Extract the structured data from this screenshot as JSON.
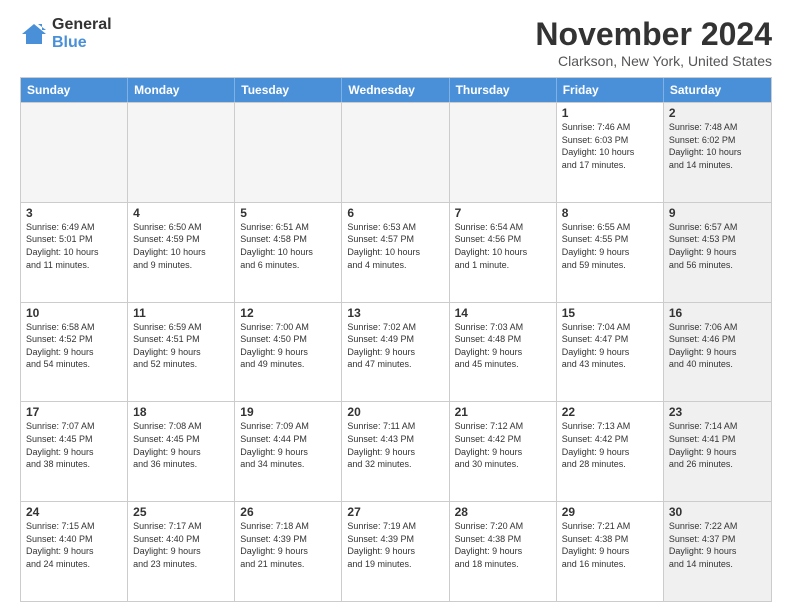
{
  "logo": {
    "general": "General",
    "blue": "Blue"
  },
  "title": "November 2024",
  "location": "Clarkson, New York, United States",
  "days_of_week": [
    "Sunday",
    "Monday",
    "Tuesday",
    "Wednesday",
    "Thursday",
    "Friday",
    "Saturday"
  ],
  "weeks": [
    [
      {
        "day": "",
        "empty": true
      },
      {
        "day": "",
        "empty": true
      },
      {
        "day": "",
        "empty": true
      },
      {
        "day": "",
        "empty": true
      },
      {
        "day": "",
        "empty": true
      },
      {
        "day": "1",
        "lines": [
          "Sunrise: 7:46 AM",
          "Sunset: 6:03 PM",
          "Daylight: 10 hours",
          "and 17 minutes."
        ]
      },
      {
        "day": "2",
        "shaded": true,
        "lines": [
          "Sunrise: 7:48 AM",
          "Sunset: 6:02 PM",
          "Daylight: 10 hours",
          "and 14 minutes."
        ]
      }
    ],
    [
      {
        "day": "3",
        "lines": [
          "Sunrise: 6:49 AM",
          "Sunset: 5:01 PM",
          "Daylight: 10 hours",
          "and 11 minutes."
        ]
      },
      {
        "day": "4",
        "lines": [
          "Sunrise: 6:50 AM",
          "Sunset: 4:59 PM",
          "Daylight: 10 hours",
          "and 9 minutes."
        ]
      },
      {
        "day": "5",
        "lines": [
          "Sunrise: 6:51 AM",
          "Sunset: 4:58 PM",
          "Daylight: 10 hours",
          "and 6 minutes."
        ]
      },
      {
        "day": "6",
        "lines": [
          "Sunrise: 6:53 AM",
          "Sunset: 4:57 PM",
          "Daylight: 10 hours",
          "and 4 minutes."
        ]
      },
      {
        "day": "7",
        "lines": [
          "Sunrise: 6:54 AM",
          "Sunset: 4:56 PM",
          "Daylight: 10 hours",
          "and 1 minute."
        ]
      },
      {
        "day": "8",
        "lines": [
          "Sunrise: 6:55 AM",
          "Sunset: 4:55 PM",
          "Daylight: 9 hours",
          "and 59 minutes."
        ]
      },
      {
        "day": "9",
        "shaded": true,
        "lines": [
          "Sunrise: 6:57 AM",
          "Sunset: 4:53 PM",
          "Daylight: 9 hours",
          "and 56 minutes."
        ]
      }
    ],
    [
      {
        "day": "10",
        "lines": [
          "Sunrise: 6:58 AM",
          "Sunset: 4:52 PM",
          "Daylight: 9 hours",
          "and 54 minutes."
        ]
      },
      {
        "day": "11",
        "lines": [
          "Sunrise: 6:59 AM",
          "Sunset: 4:51 PM",
          "Daylight: 9 hours",
          "and 52 minutes."
        ]
      },
      {
        "day": "12",
        "lines": [
          "Sunrise: 7:00 AM",
          "Sunset: 4:50 PM",
          "Daylight: 9 hours",
          "and 49 minutes."
        ]
      },
      {
        "day": "13",
        "lines": [
          "Sunrise: 7:02 AM",
          "Sunset: 4:49 PM",
          "Daylight: 9 hours",
          "and 47 minutes."
        ]
      },
      {
        "day": "14",
        "lines": [
          "Sunrise: 7:03 AM",
          "Sunset: 4:48 PM",
          "Daylight: 9 hours",
          "and 45 minutes."
        ]
      },
      {
        "day": "15",
        "lines": [
          "Sunrise: 7:04 AM",
          "Sunset: 4:47 PM",
          "Daylight: 9 hours",
          "and 43 minutes."
        ]
      },
      {
        "day": "16",
        "shaded": true,
        "lines": [
          "Sunrise: 7:06 AM",
          "Sunset: 4:46 PM",
          "Daylight: 9 hours",
          "and 40 minutes."
        ]
      }
    ],
    [
      {
        "day": "17",
        "lines": [
          "Sunrise: 7:07 AM",
          "Sunset: 4:45 PM",
          "Daylight: 9 hours",
          "and 38 minutes."
        ]
      },
      {
        "day": "18",
        "lines": [
          "Sunrise: 7:08 AM",
          "Sunset: 4:45 PM",
          "Daylight: 9 hours",
          "and 36 minutes."
        ]
      },
      {
        "day": "19",
        "lines": [
          "Sunrise: 7:09 AM",
          "Sunset: 4:44 PM",
          "Daylight: 9 hours",
          "and 34 minutes."
        ]
      },
      {
        "day": "20",
        "lines": [
          "Sunrise: 7:11 AM",
          "Sunset: 4:43 PM",
          "Daylight: 9 hours",
          "and 32 minutes."
        ]
      },
      {
        "day": "21",
        "lines": [
          "Sunrise: 7:12 AM",
          "Sunset: 4:42 PM",
          "Daylight: 9 hours",
          "and 30 minutes."
        ]
      },
      {
        "day": "22",
        "lines": [
          "Sunrise: 7:13 AM",
          "Sunset: 4:42 PM",
          "Daylight: 9 hours",
          "and 28 minutes."
        ]
      },
      {
        "day": "23",
        "shaded": true,
        "lines": [
          "Sunrise: 7:14 AM",
          "Sunset: 4:41 PM",
          "Daylight: 9 hours",
          "and 26 minutes."
        ]
      }
    ],
    [
      {
        "day": "24",
        "lines": [
          "Sunrise: 7:15 AM",
          "Sunset: 4:40 PM",
          "Daylight: 9 hours",
          "and 24 minutes."
        ]
      },
      {
        "day": "25",
        "lines": [
          "Sunrise: 7:17 AM",
          "Sunset: 4:40 PM",
          "Daylight: 9 hours",
          "and 23 minutes."
        ]
      },
      {
        "day": "26",
        "lines": [
          "Sunrise: 7:18 AM",
          "Sunset: 4:39 PM",
          "Daylight: 9 hours",
          "and 21 minutes."
        ]
      },
      {
        "day": "27",
        "lines": [
          "Sunrise: 7:19 AM",
          "Sunset: 4:39 PM",
          "Daylight: 9 hours",
          "and 19 minutes."
        ]
      },
      {
        "day": "28",
        "lines": [
          "Sunrise: 7:20 AM",
          "Sunset: 4:38 PM",
          "Daylight: 9 hours",
          "and 18 minutes."
        ]
      },
      {
        "day": "29",
        "lines": [
          "Sunrise: 7:21 AM",
          "Sunset: 4:38 PM",
          "Daylight: 9 hours",
          "and 16 minutes."
        ]
      },
      {
        "day": "30",
        "shaded": true,
        "lines": [
          "Sunrise: 7:22 AM",
          "Sunset: 4:37 PM",
          "Daylight: 9 hours",
          "and 14 minutes."
        ]
      }
    ]
  ]
}
